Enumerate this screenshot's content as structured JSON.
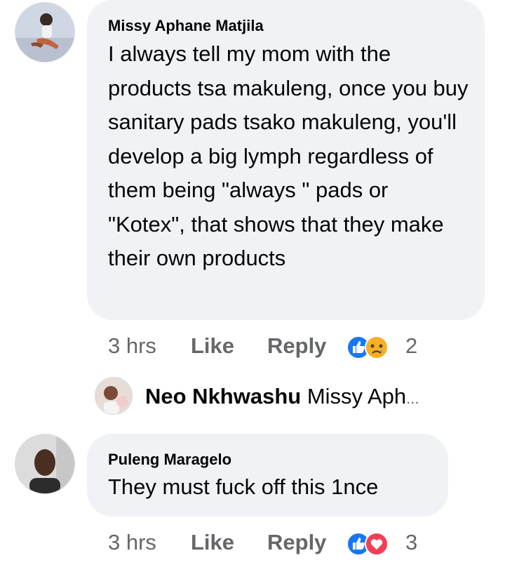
{
  "comments": [
    {
      "author": "Missy Aphane Matjila",
      "text": "I always tell my mom with the products tsa makuleng, once you buy sanitary pads tsako makuleng, you'll develop a big lymph regardless of them being \"always \" pads or \"Kotex\", that shows that they make their own products",
      "time": "3 hrs",
      "like_label": "Like",
      "reply_label": "Reply",
      "reaction_count": "2",
      "reactions": [
        "like-icon",
        "sad-icon"
      ]
    },
    {
      "author": "Puleng Maragelo",
      "text": "They must fuck off this 1nce",
      "time": "3 hrs",
      "like_label": "Like",
      "reply_label": "Reply",
      "reaction_count": "3",
      "reactions": [
        "like-icon",
        "love-icon"
      ]
    }
  ],
  "reply_preview": {
    "author": "Neo Nkhwashu",
    "snippet": "Missy Aph",
    "ellipsis": "..."
  },
  "colors": {
    "bubble": "#f0f2f5",
    "meta": "#65676b",
    "like_blue": "#1877f2",
    "love_red": "#f33e58",
    "sad_yellow": "#f7b125"
  }
}
